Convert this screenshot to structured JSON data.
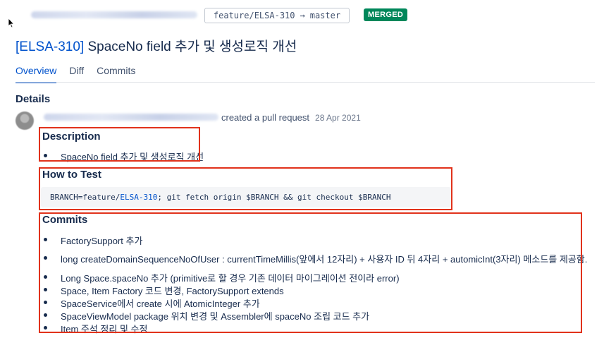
{
  "header": {
    "source_branch": "feature/ELSA-310",
    "arrow": "→",
    "target_branch": "master",
    "status": "MERGED"
  },
  "title": {
    "key": "[ELSA-310]",
    "text": "SpaceNo field 추가 및 생성로직 개선"
  },
  "tabs": [
    "Overview",
    "Diff",
    "Commits"
  ],
  "details": {
    "heading": "Details",
    "action": "created a pull request",
    "date": "28 Apr 2021"
  },
  "description": {
    "heading": "Description",
    "items": [
      "SpaceNo field 추가 및 생성로직 개선"
    ]
  },
  "how_to_test": {
    "heading": "How to Test",
    "code_prefix": "BRANCH=feature/",
    "code_key": "ELSA-310",
    "code_suffix": "; git fetch origin $BRANCH && git checkout $BRANCH"
  },
  "commits": {
    "heading": "Commits",
    "items": [
      "FactorySupport 추가",
      "long createDomainSequenceNoOfUser : currentTimeMillis(앞에서 12자리) + 사용자 ID 뒤 4자리 + automicInt(3자리) 메소드를 제공함.",
      "Long Space.spaceNo 추가 (primitive로 할 경우 기존 데이터 마이그레이션 전이라 error)",
      "Space, Item Factory 코드 변경, FactorySupport extends",
      "SpaceService에서 create 시에 AtomicInteger 추가",
      "SpaceViewModel package 위치 변경 및 Assembler에 spaceNo 조립 코드 추가",
      "Item 주석 정리 및 수정"
    ]
  },
  "colors": {
    "accent": "#0052cc",
    "merged": "#00875a",
    "highlight_box": "#e1321b"
  }
}
